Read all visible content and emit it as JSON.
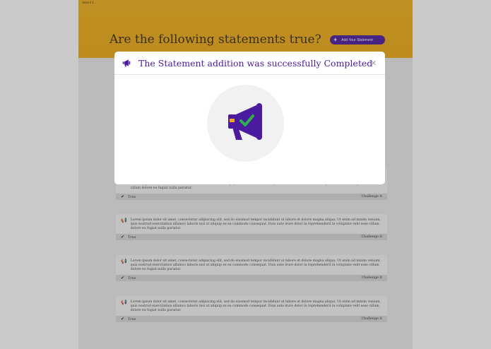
{
  "brand": "ame11",
  "hero": {
    "title": "Are the following statements true?",
    "add_button_label": "Add Your Statement"
  },
  "cards": [
    {
      "text": "veniam, quis nostrud exercitation ullamco laboris nisi ut aliquip ex ea commodo consequat. Duis aute irure dolor in reprehenderit in voluptate velit esse cillum dolore eu fugiat nulla pariatur.",
      "status": "True",
      "action": "Challenge it"
    },
    {
      "text": "Lorem ipsum dolor sit amet, consectetur adipiscing elit, sed do eiusmod tempor incididunt ut labore et dolore magna aliqua. Ut enim ad minim veniam, quis nostrud exercitation ullamco laboris nisi ut aliquip ex ea commodo consequat. Duis aute irure dolor in reprehenderit in voluptate velit esse cillum dolore eu fugiat nulla pariatur.",
      "status": "True",
      "action": "Challenge it"
    },
    {
      "text": "Lorem ipsum dolor sit amet, consectetur adipiscing elit, sed do eiusmod tempor incididunt ut labore et dolore magna aliqua. Ut enim ad minim veniam, quis nostrud exercitation ullamco laboris nisi ut aliquip ex ea commodo consequat. Duis aute irure dolor in reprehenderit in voluptate velit esse cillum dolore eu fugiat nulla pariatur.",
      "status": "True",
      "action": "Challenge it"
    },
    {
      "text": "Lorem ipsum dolor sit amet, consectetur adipiscing elit, sed do eiusmod tempor incididunt ut labore et dolore magna aliqua. Ut enim ad minim veniam, quis nostrud exercitation ullamco laboris nisi ut aliquip ex ea commodo consequat. Duis aute irure dolor in reprehenderit in voluptate velit esse cillum dolore eu fugiat nulla pariatur.",
      "status": "True",
      "action": "Challenge it"
    }
  ],
  "modal": {
    "title": "The Statement addition was successfully Completed",
    "close_label": "×",
    "header_icon": "megaphone-icon",
    "illustration_icon": "megaphone-check-icon"
  },
  "colors": {
    "accent": "#4b1a9e",
    "hero_bg": "#f0aa12",
    "success": "#2bb24c",
    "highlight": "#f5a623"
  }
}
